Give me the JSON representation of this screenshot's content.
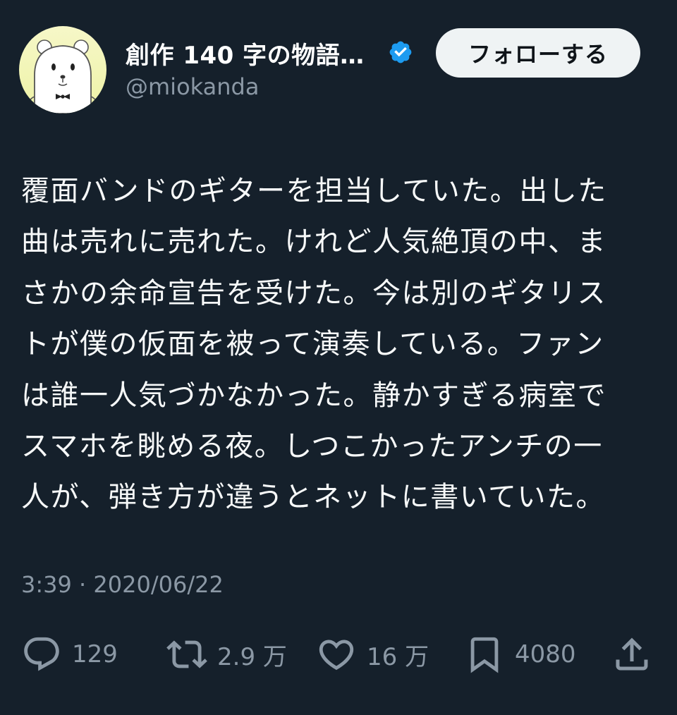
{
  "author": {
    "display_name": "創作 140 字の物語…",
    "handle": "@miokanda",
    "avatar_icon": "bear-avatar-icon",
    "verified_icon": "verified-badge-icon",
    "verified_color": "#1d9bf0"
  },
  "follow_button": {
    "label": "フォローする"
  },
  "tweet": {
    "lines": [
      "覆面バンドのギターを担当していた。出した",
      "曲は売れに売れた。けれど人気絶頂の中、ま",
      "さかの余命宣告を受けた。今は別のギタリス",
      "トが僕の仮面を被って演奏している。ファン",
      "は誰一人気づかなかった。静かすぎる病室で",
      "スマホを眺める夜。しつこかったアンチの一",
      "人が、弾き方が違うとネットに書いていた。"
    ],
    "timestamp": "3:39 · 2020/06/22"
  },
  "actions": {
    "reply": {
      "icon": "reply-icon",
      "count": "129"
    },
    "retweet": {
      "icon": "retweet-icon",
      "count": "2.9 万"
    },
    "like": {
      "icon": "heart-icon",
      "count": "16 万"
    },
    "bookmark": {
      "icon": "bookmark-icon",
      "count": "4080"
    },
    "share": {
      "icon": "share-icon"
    }
  },
  "colors": {
    "background": "#15202b",
    "text": "#ffffff",
    "muted": "#8b98a5",
    "follow_bg": "#eff3f4",
    "follow_text": "#0f1419"
  }
}
